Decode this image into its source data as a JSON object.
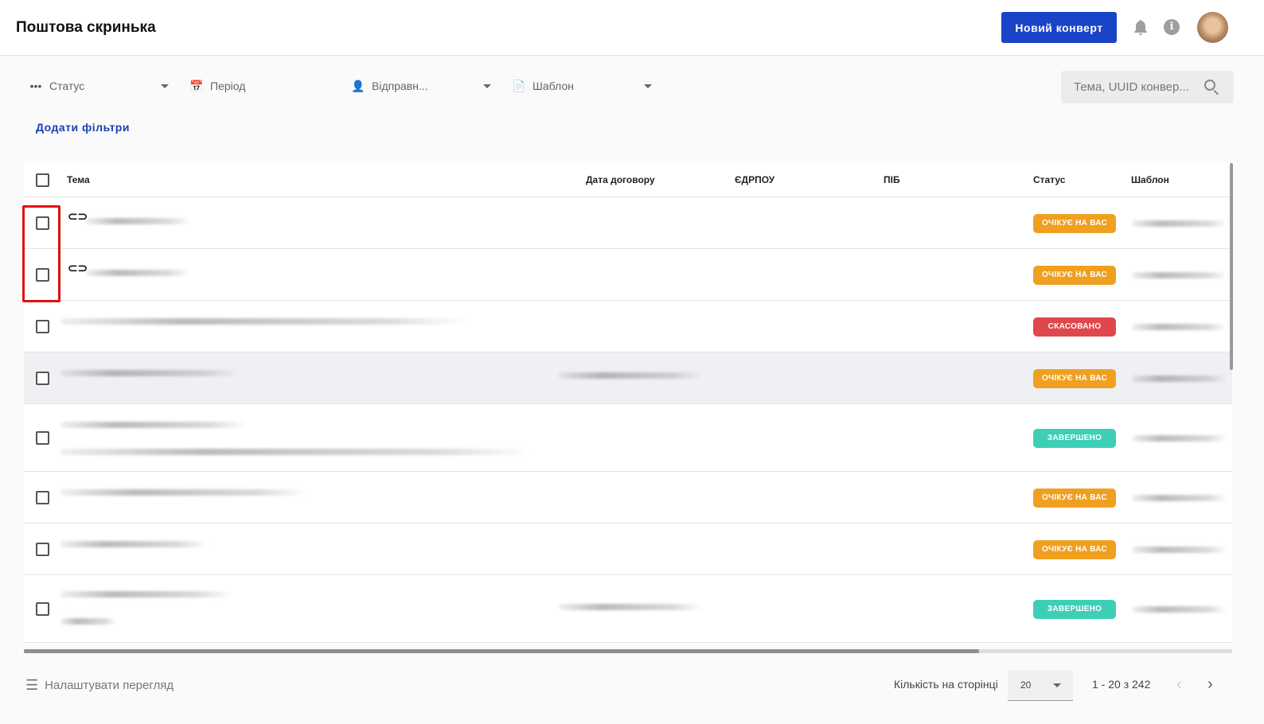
{
  "header": {
    "title": "Поштова скринька",
    "new_envelope": "Новий конверт"
  },
  "filters": {
    "status": "Статус",
    "period": "Період",
    "sender": "Відправн...",
    "template": "Шаблон",
    "search_placeholder": "Тема, UUID конвер...",
    "add_filters": "Додати фільтри"
  },
  "table": {
    "columns": {
      "subject": "Тема",
      "contract_date": "Дата договору",
      "edrpou": "ЄДРПОУ",
      "name": "ПІБ",
      "status": "Статус",
      "template": "Шаблон"
    },
    "rows": [
      {
        "status": "ОЧІКУЄ НА ВАС",
        "status_color": "#f0a020",
        "linked": true
      },
      {
        "status": "ОЧІКУЄ НА ВАС",
        "status_color": "#f0a020",
        "linked": true
      },
      {
        "status": "СКАСОВАНО",
        "status_color": "#e0474c",
        "linked": false
      },
      {
        "status": "ОЧІКУЄ НА ВАС",
        "status_color": "#f0a020",
        "linked": false
      },
      {
        "status": "ЗАВЕРШЕНО",
        "status_color": "#3dcfb6",
        "linked": false
      },
      {
        "status": "ОЧІКУЄ НА ВАС",
        "status_color": "#f0a020",
        "linked": false
      },
      {
        "status": "ОЧІКУЄ НА ВАС",
        "status_color": "#f0a020",
        "linked": false
      },
      {
        "status": "ЗАВЕРШЕНО",
        "status_color": "#3dcfb6",
        "linked": false
      }
    ]
  },
  "footer": {
    "customize_view": "Налаштувати перегляд",
    "per_page_label": "Кількість на сторінці",
    "per_page": "20",
    "range": "1 - 20 з 242"
  }
}
